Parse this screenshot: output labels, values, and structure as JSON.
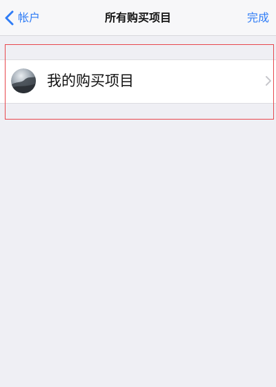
{
  "navbar": {
    "back_label": "帐户",
    "title": "所有购买项目",
    "done_label": "完成"
  },
  "list": {
    "items": [
      {
        "label": "我的购买项目"
      }
    ]
  },
  "colors": {
    "accent": "#2f7cf6",
    "highlight": "#e8464c",
    "background": "#efeff4"
  },
  "icons": {
    "back": "chevron-left-icon",
    "row_disclosure": "chevron-right-icon",
    "avatar": "avatar-icon"
  }
}
